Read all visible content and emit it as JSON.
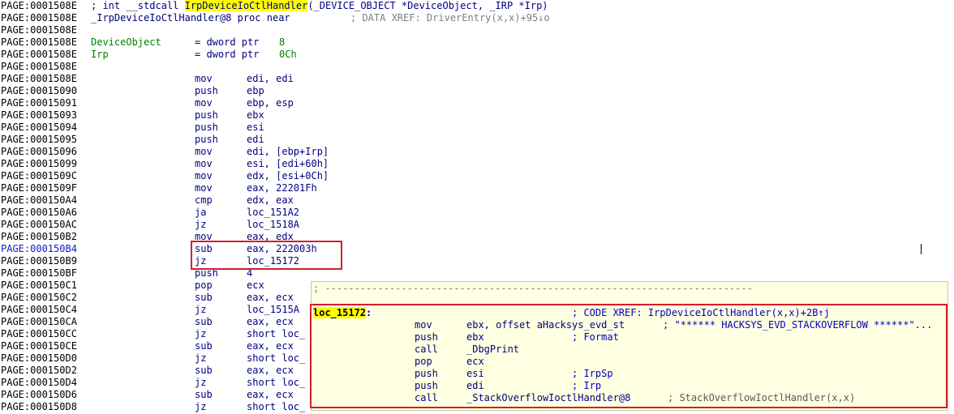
{
  "header": {
    "line1": {
      "addr": "PAGE:0001508E",
      "pre": "; int __stdcall ",
      "func": "IrpDeviceIoCtlHandler",
      "post": "(_DEVICE_OBJECT *DeviceObject, _IRP *Irp)"
    },
    "line2": {
      "addr": "PAGE:0001508E",
      "proc": "_IrpDeviceIoCtlHandler@8 proc near",
      "xref": "; DATA XREF: DriverEntry(x,x)+95↓o"
    },
    "line3": {
      "addr": "PAGE:0001508E"
    },
    "var1": {
      "addr": "PAGE:0001508E",
      "name": "DeviceObject",
      "def": "= dword ptr",
      "val": "8"
    },
    "var2": {
      "addr": "PAGE:0001508E",
      "name": "Irp",
      "def": "= dword ptr",
      "val": "0Ch"
    },
    "line6": {
      "addr": "PAGE:0001508E"
    }
  },
  "instructions": [
    {
      "addr": "PAGE:0001508E",
      "mn": "mov",
      "op": "edi, edi"
    },
    {
      "addr": "PAGE:00015090",
      "mn": "push",
      "op": "ebp"
    },
    {
      "addr": "PAGE:00015091",
      "mn": "mov",
      "op": "ebp, esp"
    },
    {
      "addr": "PAGE:00015093",
      "mn": "push",
      "op": "ebx"
    },
    {
      "addr": "PAGE:00015094",
      "mn": "push",
      "op": "esi"
    },
    {
      "addr": "PAGE:00015095",
      "mn": "push",
      "op": "edi"
    },
    {
      "addr": "PAGE:00015096",
      "mn": "mov",
      "op": "edi, [ebp+Irp]"
    },
    {
      "addr": "PAGE:00015099",
      "mn": "mov",
      "op": "esi, [edi+60h]"
    },
    {
      "addr": "PAGE:0001509C",
      "mn": "mov",
      "op": "edx, [esi+0Ch]"
    },
    {
      "addr": "PAGE:0001509F",
      "mn": "mov",
      "op": "eax, 22201Fh"
    },
    {
      "addr": "PAGE:000150A4",
      "mn": "cmp",
      "op": "edx, eax"
    },
    {
      "addr": "PAGE:000150A6",
      "mn": "ja",
      "op": "loc_151A2"
    },
    {
      "addr": "PAGE:000150AC",
      "mn": "jz",
      "op": "loc_1518A"
    },
    {
      "addr": "PAGE:000150B2",
      "mn": "mov",
      "op": "eax, edx"
    },
    {
      "addr": "PAGE:000150B4",
      "mn": "sub",
      "op": "eax, 222003h"
    },
    {
      "addr": "PAGE:000150B9",
      "mn": "jz",
      "op": "loc_15172"
    },
    {
      "addr": "PAGE:000150BF",
      "mn": "push",
      "op": "4"
    },
    {
      "addr": "PAGE:000150C1",
      "mn": "pop",
      "op": "ecx"
    },
    {
      "addr": "PAGE:000150C2",
      "mn": "sub",
      "op": "eax, ecx"
    },
    {
      "addr": "PAGE:000150C4",
      "mn": "jz",
      "op": "loc_1515A"
    },
    {
      "addr": "PAGE:000150CA",
      "mn": "sub",
      "op": "eax, ecx"
    },
    {
      "addr": "PAGE:000150CC",
      "mn": "jz",
      "op": "short loc_"
    },
    {
      "addr": "PAGE:000150CE",
      "mn": "sub",
      "op": "eax, ecx"
    },
    {
      "addr": "PAGE:000150D0",
      "mn": "jz",
      "op": "short loc_"
    },
    {
      "addr": "PAGE:000150D2",
      "mn": "sub",
      "op": "eax, ecx"
    },
    {
      "addr": "PAGE:000150D4",
      "mn": "jz",
      "op": "short loc_"
    },
    {
      "addr": "PAGE:000150D6",
      "mn": "sub",
      "op": "eax, ecx"
    },
    {
      "addr": "PAGE:000150D8",
      "mn": "jz",
      "op": "short loc_"
    }
  ],
  "popup": {
    "separator": "; -------------------------------------------------------------------------",
    "label": "loc_15172",
    "label_colon": ":",
    "label_xref": "; CODE XREF: IrpDeviceIoCtlHandler(x,x)+2B↑j",
    "lines": [
      {
        "mn": "mov",
        "op": "ebx, offset aHacksys_evd_st",
        "cmt": "; \"****** HACKSYS_EVD_STACKOVERFLOW ******\"..."
      },
      {
        "mn": "push",
        "op": "ebx",
        "cmt": "; Format"
      },
      {
        "mn": "call",
        "op": "_DbgPrint",
        "cmt": ""
      },
      {
        "mn": "pop",
        "op": "ecx",
        "cmt": ""
      },
      {
        "mn": "push",
        "op": "esi",
        "cmt": "; IrpSp"
      },
      {
        "mn": "push",
        "op": "edi",
        "cmt": "; Irp"
      },
      {
        "mn": "call",
        "op": "_StackOverflowIoctlHandler@8",
        "cmt": "; StackOverflowIoctlHandler(x,x)"
      }
    ]
  }
}
